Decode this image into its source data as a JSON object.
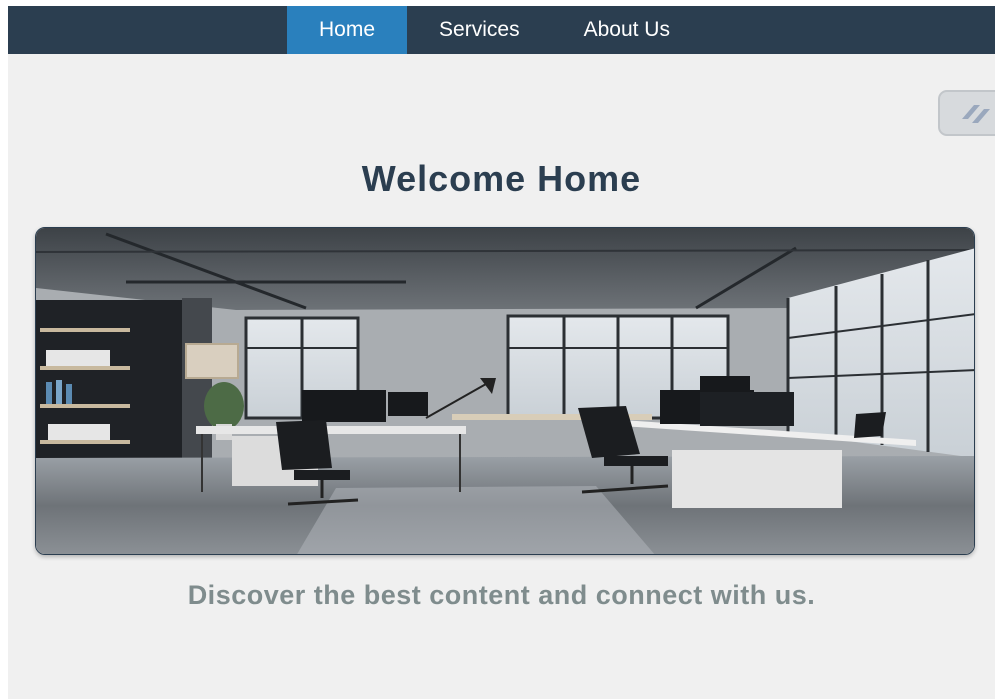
{
  "nav": {
    "items": [
      {
        "label": "Home",
        "active": true
      },
      {
        "label": "Services",
        "active": false
      },
      {
        "label": "About Us",
        "active": false
      }
    ]
  },
  "hero": {
    "title": "Welcome Home",
    "image_icon": "office-photo",
    "tagline": "Discover the best content and connect with us."
  },
  "widget": {
    "icon": "extension-icon"
  },
  "colors": {
    "navbar": "#2b3e50",
    "nav_active": "#2a80bd",
    "title": "#2b3e50",
    "tagline": "#7f8c8d",
    "page_bg": "#f0f0f0"
  }
}
